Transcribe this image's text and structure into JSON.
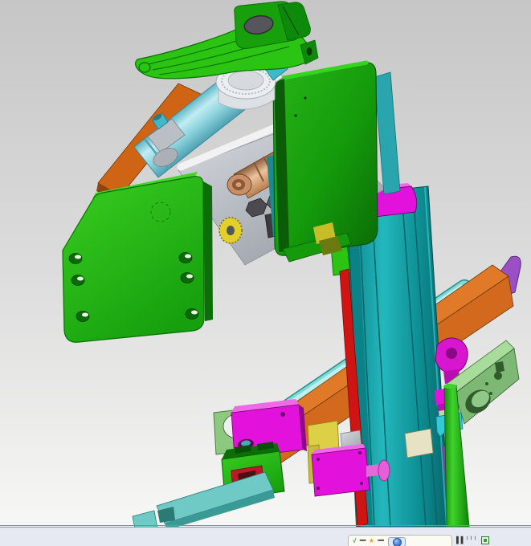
{
  "window": {
    "type": "cad-3d-assembly-viewport"
  },
  "viewport": {
    "background_top": "#c6c6c6",
    "background_bottom": "#f7f7f6"
  },
  "colors": {
    "green_bright": "#2cc412",
    "green_mid": "#179f0c",
    "green_dark": "#0c6e07",
    "green_deep": "#084f04",
    "cover_green": "#1ba310",
    "cover_edge": "#35d41f",
    "lime_bracket": "#8cc87e",
    "swing_bracket_top": "#a8dc9a",
    "swing_bracket_front": "#7db874",
    "teal_column": "#119ba0",
    "teal_dark": "#0a7478",
    "teal_strip": "#2aa5ad",
    "cyan_cylinder": "#9fdfe8",
    "cyan_knob": "#3fb9c9",
    "cyan_tube": "#7fd9d4",
    "finger_teal": "#6fc9c4",
    "finger_teal_dark": "#3a9a96",
    "rod_clamp_cyan": "#35c8d8",
    "orange_beam": "#d2691c",
    "orange_beam_top": "#e07a28",
    "orange_dark": "#8a4510",
    "orange_plate": "#cf6414",
    "magenta": "#e212dc",
    "magenta_light": "#f06ae8",
    "magenta_dark": "#90078c",
    "hook_magenta": "#d816d0",
    "knob_pink": "#e75fd8",
    "purple": "#9a4fc4",
    "purple_sliver": "#7a3fa8",
    "red_strip": "#cf1414",
    "yellow_plate": "#ddd046",
    "yellow_gear": "#e3cf2a",
    "motor_tan": "#d8a078",
    "motor_cap": "#c98f66",
    "cream_manifold": "#e7e2c4",
    "silver_plate": "#c3c6ce",
    "white_part": "#eceff1",
    "hub_dark": "#55565c",
    "bar_bg": "#e6e9f2",
    "bar_border": "#8f96a8",
    "popup_bg": "#fbfbf3",
    "popup_border": "#bdbdaa",
    "globe_blue": "#3a7ad8"
  },
  "parts": [
    {
      "name": "rocker-lever-arm",
      "color": "#2cc412"
    },
    {
      "name": "pivot-hub-clamp",
      "color": "#179f0c"
    },
    {
      "name": "bearing-housing",
      "color": "#eceff1"
    },
    {
      "name": "pneumatic-cylinder",
      "color": "#9fdfe8"
    },
    {
      "name": "cylinder-elbow-fitting",
      "color": "#b9bfc4"
    },
    {
      "name": "side-plate-orange",
      "color": "#cf6414"
    },
    {
      "name": "gearmotor",
      "color": "#d8a078"
    },
    {
      "name": "valve-manifold",
      "color": "#e7e2c4"
    },
    {
      "name": "timing-gear",
      "color": "#e3cf2a"
    },
    {
      "name": "labelled-block",
      "color": "#129a0c"
    },
    {
      "name": "housing-cover",
      "color": "#1ba310"
    },
    {
      "name": "mounting-plate",
      "color": "#2cc412"
    },
    {
      "name": "column-extrusion",
      "color": "#119ba0"
    },
    {
      "name": "column-cap",
      "color": "#e212dc"
    },
    {
      "name": "sensor-strip-red",
      "color": "#cf1414"
    },
    {
      "name": "cross-beam",
      "color": "#d2691c"
    },
    {
      "name": "beam-end-plate",
      "color": "#9a4fc4"
    },
    {
      "name": "guide-tube",
      "color": "#7fd9d4"
    },
    {
      "name": "hole-bracket",
      "color": "#8cc87e"
    },
    {
      "name": "rail-carriage",
      "color": "#e212dc"
    },
    {
      "name": "slide-plate-yellow",
      "color": "#ddd046"
    },
    {
      "name": "mini-actuator",
      "color": "#e212dc"
    },
    {
      "name": "hand-knob",
      "color": "#e75fd8"
    },
    {
      "name": "gripper-clamp",
      "color": "#2cc412"
    },
    {
      "name": "gripper-finger",
      "color": "#6fc9c4"
    },
    {
      "name": "swing-bracket",
      "color": "#a8dc9a"
    },
    {
      "name": "support-rod",
      "color": "#2dc41e"
    },
    {
      "name": "rod-clamp",
      "color": "#35c8d8"
    },
    {
      "name": "hook-link",
      "color": "#d816d0"
    }
  ],
  "labels": {
    "block_vertical_label": "▪▪▪▪▪▪▪▪"
  },
  "statusbar": {
    "popup": {
      "item1_icon": "√",
      "item1_text": "▪▪▪▪▪",
      "item2_icon": "★",
      "item2_text": "▪▪▪▪▪"
    },
    "ime_glyphs": "▌▌╵╵╵"
  }
}
